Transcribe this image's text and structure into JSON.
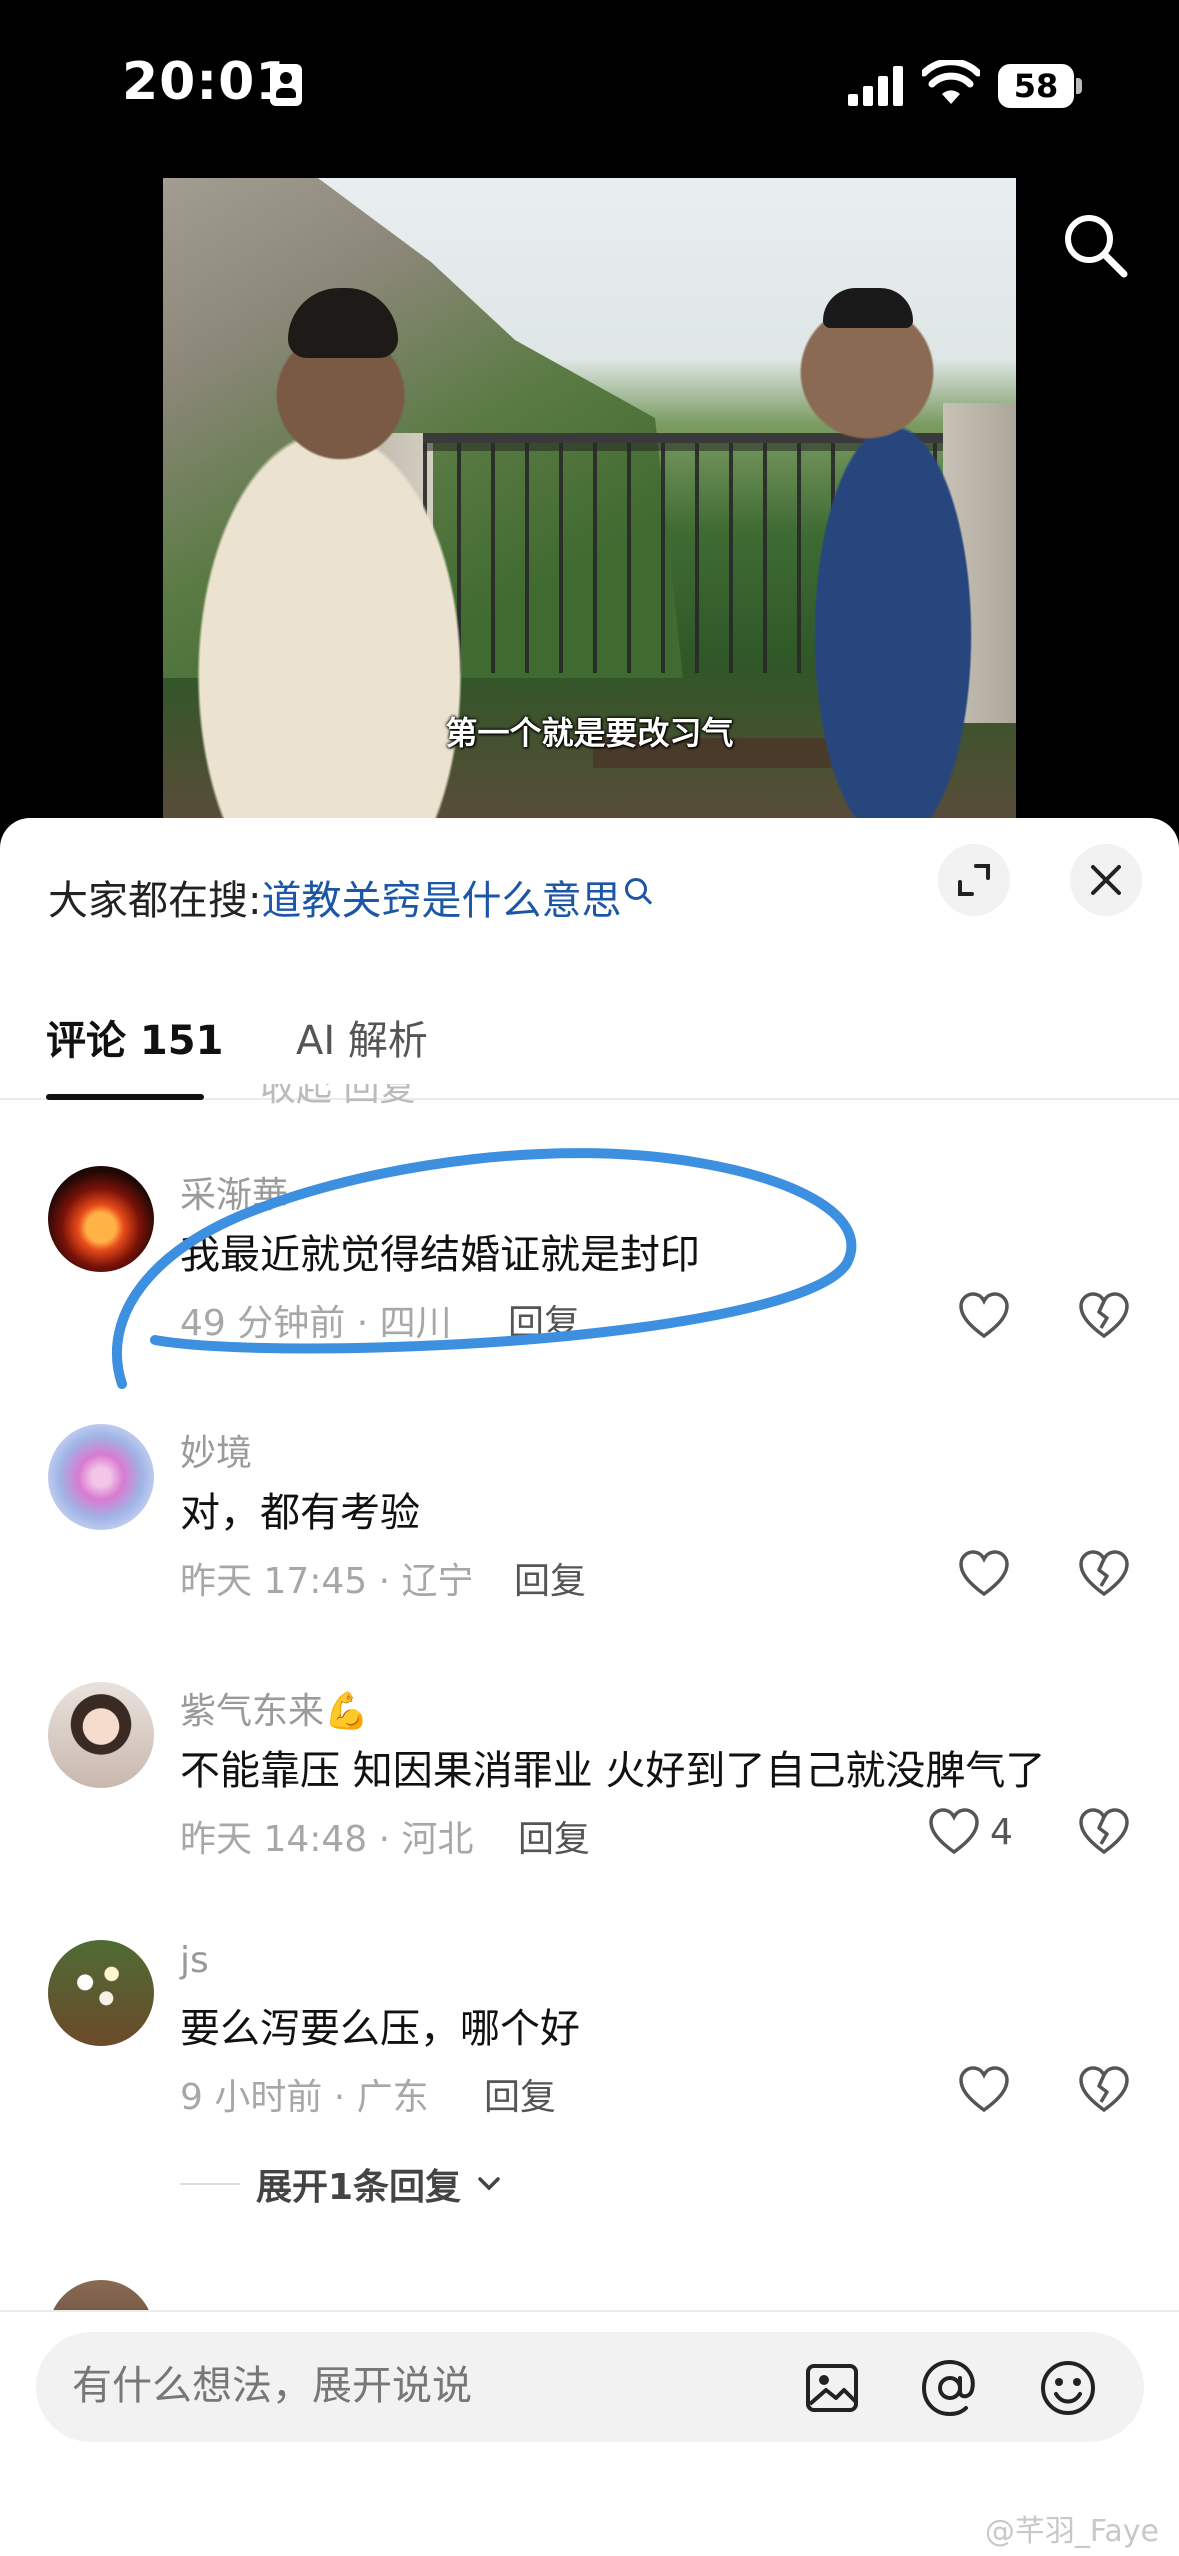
{
  "status_bar": {
    "time": "20:01",
    "battery": "58"
  },
  "video": {
    "caption": "第一个就是要改习气"
  },
  "search_hint": {
    "prefix": "大家都在搜:",
    "query": "道教关窍是什么意思"
  },
  "tabs": {
    "comments": "评论 151",
    "ai": "AI 解析"
  },
  "comments": [
    {
      "name": "采渐華",
      "text": "我最近就觉得结婚证就是封印",
      "meta": "49 分钟前 · 四川",
      "reply": "回复",
      "likes": ""
    },
    {
      "name": "妙境",
      "text": "对，都有考验",
      "meta": "昨天 17:45 · 辽宁",
      "reply": "回复",
      "likes": ""
    },
    {
      "name": "紫气东来💪",
      "text": "不能靠压 知因果消罪业 火好到了自己就没脾气了",
      "meta": "昨天 14:48 · 河北",
      "reply": "回复",
      "likes": "4"
    },
    {
      "name": "js",
      "text": "要么泻要么压，哪个好",
      "meta": "9 小时前 · 广东",
      "reply": "回复",
      "likes": ""
    }
  ],
  "expand_replies": "展开1条回复",
  "input": {
    "placeholder": "有什么想法，展开说说"
  },
  "watermark": "@芊羽_Faye",
  "colors": {
    "annotation": "#3d8fe0",
    "link": "#1c56a6"
  }
}
